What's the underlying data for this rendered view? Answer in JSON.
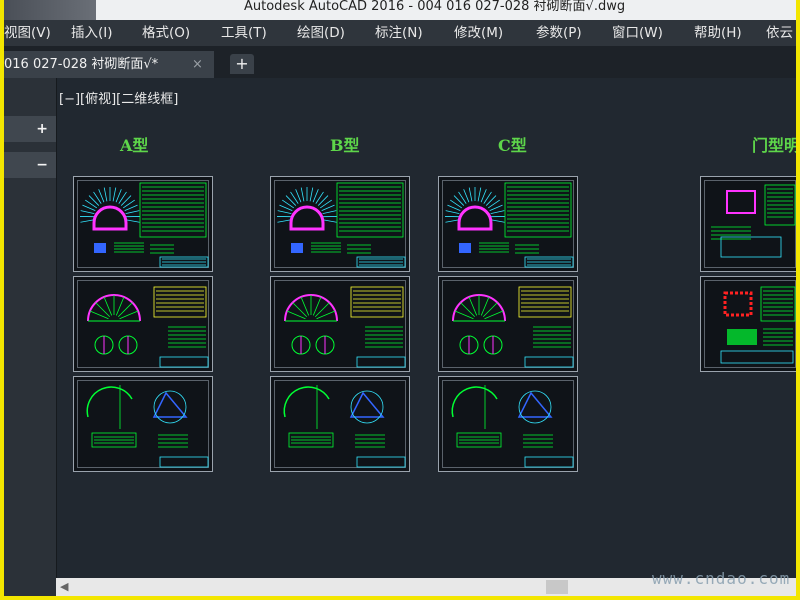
{
  "window": {
    "title": "Autodesk AutoCAD 2016 - 004 016 027-028 衬砌断面√.dwg"
  },
  "menu": [
    {
      "label": "视图(V)"
    },
    {
      "label": "插入(I)"
    },
    {
      "label": "格式(O)"
    },
    {
      "label": "工具(T)"
    },
    {
      "label": "绘图(D)"
    },
    {
      "label": "标注(N)"
    },
    {
      "label": "修改(M)"
    },
    {
      "label": "参数(P)"
    },
    {
      "label": "窗口(W)"
    },
    {
      "label": "帮助(H)"
    },
    {
      "label": "依云"
    }
  ],
  "tab": {
    "label": "016  027-028 衬砌断面√*",
    "close": "×",
    "new": "+"
  },
  "panel": {
    "expand": "+",
    "collapse": "−"
  },
  "viewport": {
    "label": "[−][俯视][二维线框]"
  },
  "drawing": {
    "type_labels": [
      "A型",
      "B型",
      "C型",
      "门型明"
    ]
  },
  "watermark": "www.cndao.com",
  "colors": {
    "cad_green": "#00ff33",
    "cad_magenta": "#ff33ff",
    "cad_cyan": "#33e6ff",
    "cad_yellow": "#ffff33",
    "cad_blue": "#3366ff",
    "cad_red": "#ff2222"
  }
}
